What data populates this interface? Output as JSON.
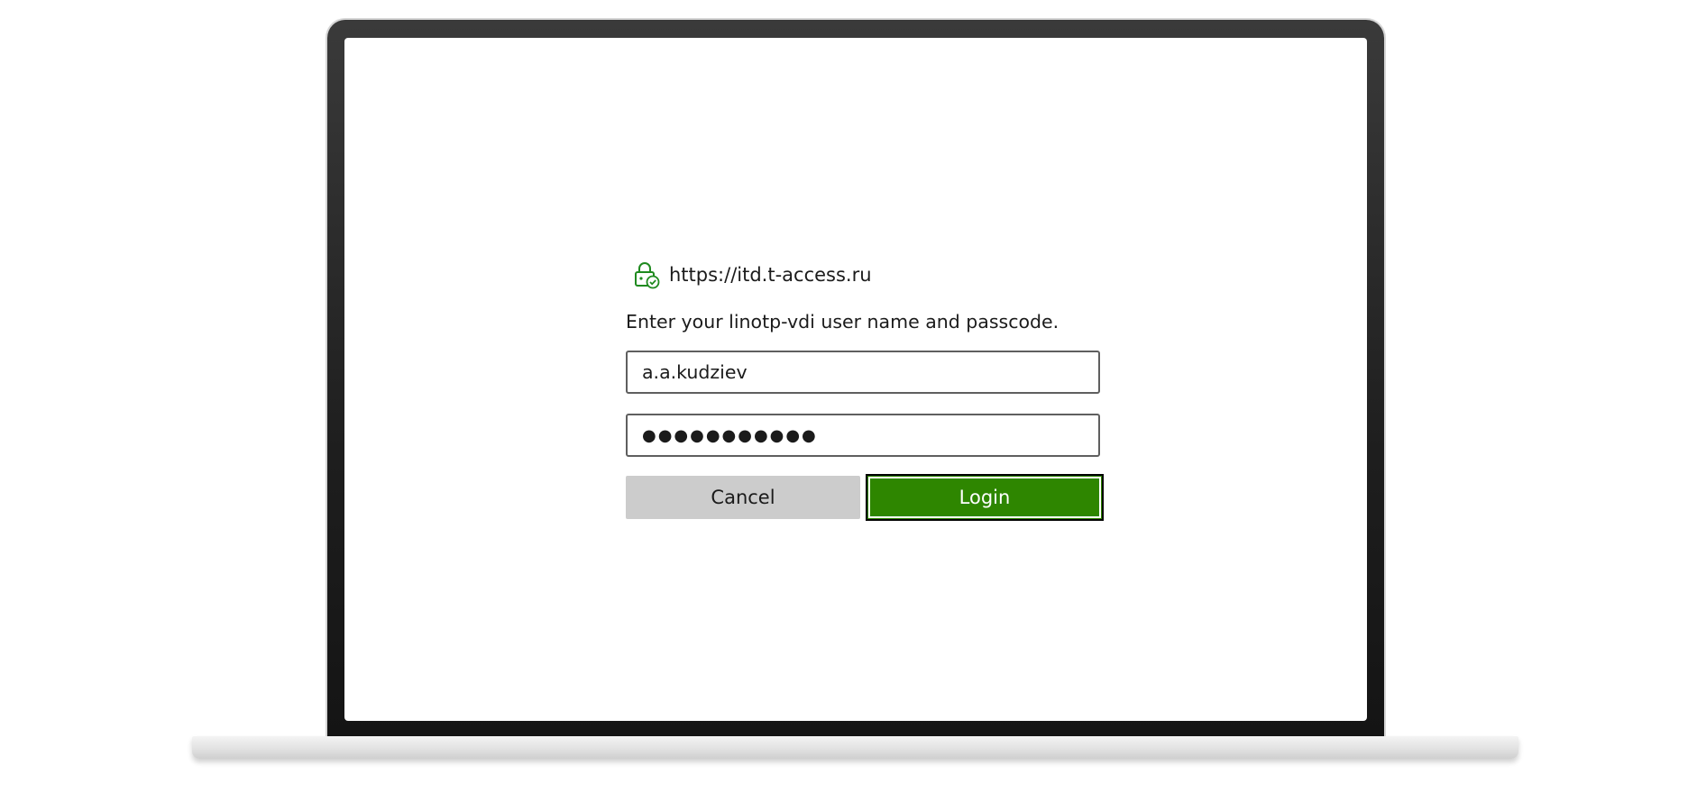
{
  "dialog": {
    "origin": "https://itd.t-access.ru",
    "prompt": "Enter your linotp-vdi user name and passcode.",
    "username": {
      "value": "a.a.kudziev"
    },
    "password": {
      "masked_value": "●●●●●●●●●●●"
    },
    "cancel_label": "Cancel",
    "login_label": "Login"
  },
  "icons": {
    "origin_icon": "lock-check-icon"
  },
  "colors": {
    "accent_green": "#2e8600",
    "icon_green": "#1f8a1f",
    "cancel_gray": "#cccccc"
  }
}
